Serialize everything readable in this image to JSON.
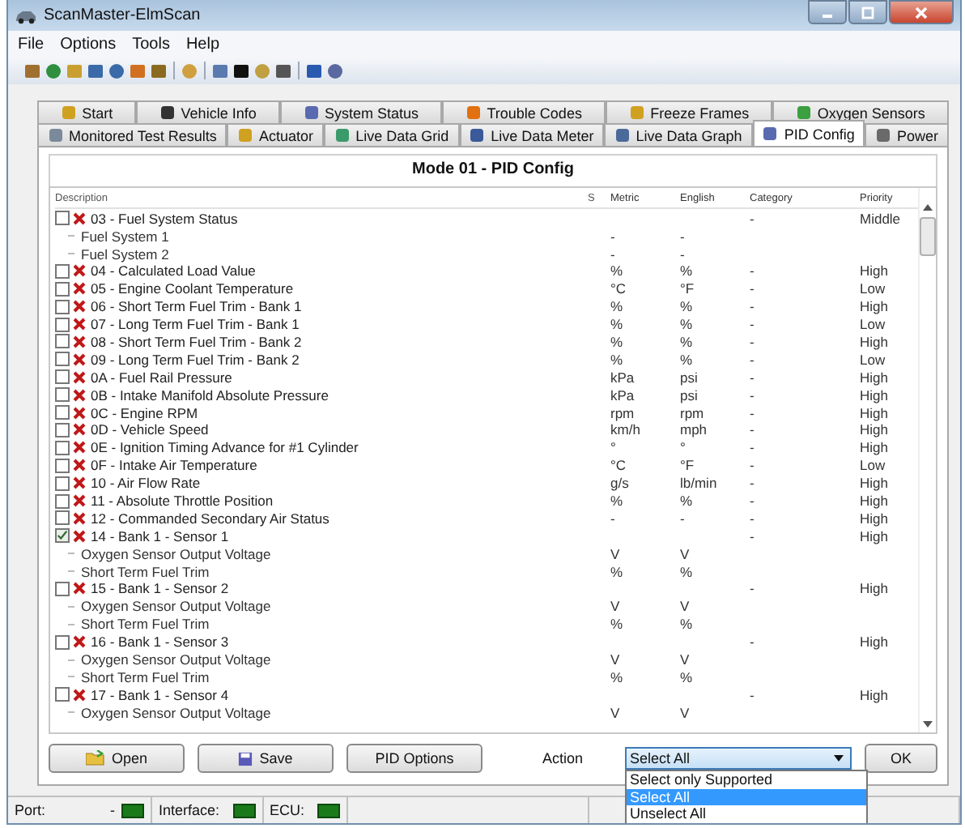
{
  "window": {
    "title": "ScanMaster-ElmScan"
  },
  "menu": [
    "File",
    "Options",
    "Tools",
    "Help"
  ],
  "tab_rows": [
    [
      {
        "label": "Start",
        "selected": false
      },
      {
        "label": "Vehicle Info",
        "selected": false
      },
      {
        "label": "System Status",
        "selected": false
      },
      {
        "label": "Trouble Codes",
        "selected": false
      },
      {
        "label": "Freeze Frames",
        "selected": false
      },
      {
        "label": "Oxygen Sensors",
        "selected": false
      }
    ],
    [
      {
        "label": "Monitored Test Results",
        "selected": false
      },
      {
        "label": "Actuator",
        "selected": false
      },
      {
        "label": "Live Data Grid",
        "selected": false
      },
      {
        "label": "Live Data Meter",
        "selected": false
      },
      {
        "label": "Live Data Graph",
        "selected": false
      },
      {
        "label": "PID Config",
        "selected": true
      },
      {
        "label": "Power",
        "selected": false
      }
    ]
  ],
  "panel": {
    "title": "Mode 01 - PID Config"
  },
  "table": {
    "columns": [
      "Description",
      "S",
      "Metric",
      "English",
      "Category",
      "Priority"
    ],
    "rows": [
      {
        "label": "03 - Fuel System Status",
        "checked": false,
        "supported": false,
        "category": "-",
        "priority": "Middle",
        "children": [
          {
            "label": "Fuel System 1",
            "metric": "-",
            "english": "-"
          },
          {
            "label": "Fuel System 2",
            "metric": "-",
            "english": "-"
          }
        ]
      },
      {
        "label": "04 - Calculated Load Value",
        "checked": false,
        "supported": false,
        "metric": "%",
        "english": "%",
        "category": "-",
        "priority": "High"
      },
      {
        "label": "05 - Engine Coolant Temperature",
        "checked": false,
        "supported": false,
        "metric": "°C",
        "english": "°F",
        "category": "-",
        "priority": "Low"
      },
      {
        "label": "06 - Short Term Fuel Trim - Bank 1",
        "checked": false,
        "supported": false,
        "metric": "%",
        "english": "%",
        "category": "-",
        "priority": "High"
      },
      {
        "label": "07 - Long Term Fuel Trim - Bank 1",
        "checked": false,
        "supported": false,
        "metric": "%",
        "english": "%",
        "category": "-",
        "priority": "Low"
      },
      {
        "label": "08 - Short Term Fuel Trim - Bank 2",
        "checked": false,
        "supported": false,
        "metric": "%",
        "english": "%",
        "category": "-",
        "priority": "High"
      },
      {
        "label": "09 - Long Term Fuel Trim - Bank 2",
        "checked": false,
        "supported": false,
        "metric": "%",
        "english": "%",
        "category": "-",
        "priority": "Low"
      },
      {
        "label": "0A - Fuel Rail Pressure",
        "checked": false,
        "supported": false,
        "metric": "kPa",
        "english": "psi",
        "category": "-",
        "priority": "High"
      },
      {
        "label": "0B - Intake Manifold Absolute Pressure",
        "checked": false,
        "supported": false,
        "metric": "kPa",
        "english": "psi",
        "category": "-",
        "priority": "High"
      },
      {
        "label": "0C - Engine RPM",
        "checked": false,
        "supported": false,
        "metric": "rpm",
        "english": "rpm",
        "category": "-",
        "priority": "High"
      },
      {
        "label": "0D - Vehicle Speed",
        "checked": false,
        "supported": false,
        "metric": "km/h",
        "english": "mph",
        "category": "-",
        "priority": "High"
      },
      {
        "label": "0E - Ignition Timing Advance for #1 Cylinder",
        "checked": false,
        "supported": false,
        "metric": "°",
        "english": "°",
        "category": "-",
        "priority": "High"
      },
      {
        "label": "0F - Intake Air Temperature",
        "checked": false,
        "supported": false,
        "metric": "°C",
        "english": "°F",
        "category": "-",
        "priority": "Low"
      },
      {
        "label": "10 - Air Flow Rate",
        "checked": false,
        "supported": false,
        "metric": "g/s",
        "english": "lb/min",
        "category": "-",
        "priority": "High"
      },
      {
        "label": "11 - Absolute Throttle Position",
        "checked": false,
        "supported": false,
        "metric": "%",
        "english": "%",
        "category": "-",
        "priority": "High"
      },
      {
        "label": "12 - Commanded Secondary Air Status",
        "checked": false,
        "supported": false,
        "metric": "-",
        "english": "-",
        "category": "-",
        "priority": "High"
      },
      {
        "label": "14 - Bank 1 - Sensor 1",
        "checked": true,
        "supported": false,
        "category": "-",
        "priority": "High",
        "children": [
          {
            "label": "Oxygen Sensor Output Voltage",
            "metric": "V",
            "english": "V"
          },
          {
            "label": "Short Term Fuel Trim",
            "metric": "%",
            "english": "%"
          }
        ]
      },
      {
        "label": "15 - Bank 1 - Sensor 2",
        "checked": false,
        "supported": false,
        "category": "-",
        "priority": "High",
        "children": [
          {
            "label": "Oxygen Sensor Output Voltage",
            "metric": "V",
            "english": "V"
          },
          {
            "label": "Short Term Fuel Trim",
            "metric": "%",
            "english": "%"
          }
        ]
      },
      {
        "label": "16 - Bank 1 - Sensor 3",
        "checked": false,
        "supported": false,
        "category": "-",
        "priority": "High",
        "children": [
          {
            "label": "Oxygen Sensor Output Voltage",
            "metric": "V",
            "english": "V"
          },
          {
            "label": "Short Term Fuel Trim",
            "metric": "%",
            "english": "%"
          }
        ]
      },
      {
        "label": "17 - Bank 1 - Sensor 4",
        "checked": false,
        "supported": false,
        "category": "-",
        "priority": "High",
        "children": [
          {
            "label": "Oxygen Sensor Output Voltage",
            "metric": "V",
            "english": "V"
          }
        ]
      }
    ]
  },
  "buttons": [
    {
      "label": "Open",
      "kind": "open"
    },
    {
      "label": "Save",
      "kind": "save"
    },
    {
      "label": "PID Options",
      "kind": "plain"
    }
  ],
  "action": {
    "label": "Action",
    "value": "Select All",
    "options": [
      {
        "label": "Select only Supported",
        "selected": false
      },
      {
        "label": "Select All",
        "selected": true
      },
      {
        "label": "Unselect All",
        "selected": false
      }
    ]
  },
  "ok_button": "OK",
  "status_bar": [
    {
      "label": "Port:",
      "value": "-"
    },
    {
      "label": "Interface:"
    },
    {
      "label": "ECU:"
    }
  ]
}
